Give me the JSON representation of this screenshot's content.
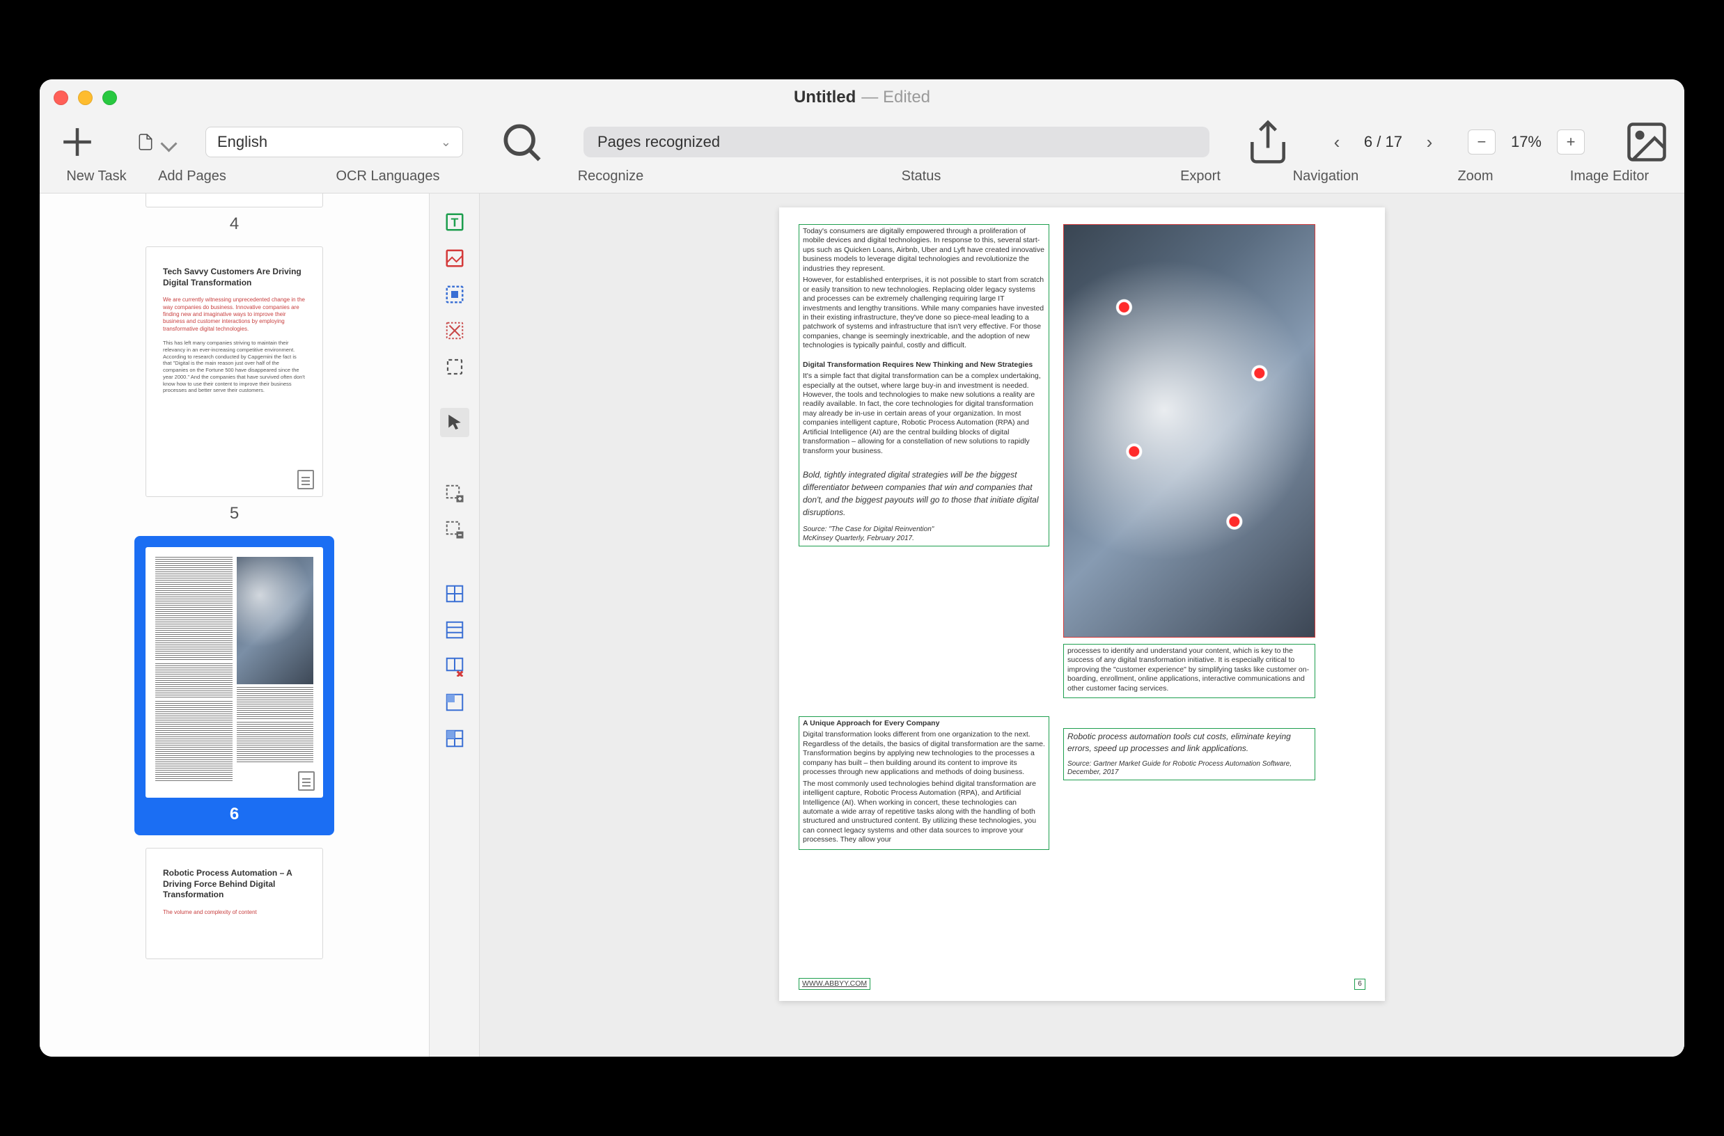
{
  "window": {
    "title": "Untitled",
    "edited": "— Edited"
  },
  "toolbar": {
    "newTask": "New Task",
    "addPages": "Add Pages",
    "language": "English",
    "ocrLanguages": "OCR Languages",
    "recognize": "Recognize",
    "status": "Status",
    "statusValue": "Pages recognized",
    "export": "Export",
    "navigation": "Navigation",
    "pageCounter": "6 / 17",
    "zoom": "Zoom",
    "zoomValue": "17%",
    "imageEditor": "Image Editor"
  },
  "thumbs": {
    "t4": {
      "label": "4"
    },
    "t5": {
      "label": "5",
      "head": "Tech Savvy Customers Are Driving Digital Transformation",
      "red": "We are currently witnessing unprecedented change in the way companies do business. Innovative companies are finding new and imaginative ways to improve their business and customer interactions by employing transformative digital technologies.",
      "body": "This has left many companies striving to maintain their relevancy in an ever-increasing competitive environment. According to research conducted by Capgemini the fact is that \"Digital is the main reason just over half of the companies on the Fortune 500 have disappeared since the year 2000.\" And the companies that have survived often don't know how to use their content to improve their business processes and better serve their customers."
    },
    "t6": {
      "label": "6"
    },
    "t7": {
      "head": "Robotic Process Automation – A Driving Force Behind Digital Transformation",
      "red": "The volume and complexity of content"
    }
  },
  "page": {
    "b1": {
      "p1": "Today's consumers are digitally empowered through a proliferation of mobile devices and digital technologies. In response to this, several start-ups such as Quicken Loans, Airbnb, Uber and Lyft have created innovative business models to leverage digital technologies and revolutionize the industries they represent.",
      "p2": "However, for established enterprises, it is not possible to start from scratch or easily transition to new technologies. Replacing older legacy systems and processes can be extremely challenging requiring large IT investments and lengthy transitions. While many companies have invested in their existing infrastructure, they've done so piece-meal leading to a patchwork of systems and infrastructure that isn't very effective. For those companies, change is seemingly inextricable, and the adoption of new technologies is typically painful, costly and difficult.",
      "head": "Digital Transformation Requires New Thinking and New Strategies",
      "p3": "It's a simple fact that digital transformation can be a complex undertaking, especially at the outset, where large buy-in and investment is needed. However, the tools and technologies to make new solutions a reality are readily available. In fact, the core technologies for digital transformation may already be in-use in certain areas of your organization. In most companies intelligent capture, Robotic Process Automation (RPA) and Artificial Intelligence (AI) are the central building blocks of digital transformation – allowing for a constellation of new solutions to rapidly transform your business.",
      "quote": "Bold, tightly integrated digital strategies will be the biggest differentiator between companies that win and companies that don't, and the biggest payouts will go to those that initiate digital disruptions.",
      "src1": "Source: \"The Case for Digital Reinvention\"",
      "src2": "McKinsey Quarterly, February 2017."
    },
    "b2": {
      "head": "A Unique Approach for Every Company",
      "p1": "Digital transformation looks different from one organization to the next. Regardless of the details, the basics of digital transformation are the same. Transformation begins by applying new technologies to the processes a company has built – then building around its content to improve its processes through new applications and methods of doing business.",
      "p2": "The most commonly used technologies behind digital transformation are intelligent capture, Robotic Process Automation (RPA), and Artificial Intelligence (AI). When working in concert, these technologies can automate a wide array of repetitive tasks along with the handling of both structured and unstructured content. By utilizing these technologies, you can connect legacy systems and other data sources to improve your processes. They allow your"
    },
    "b3": {
      "p1": "processes to identify and understand your content, which is key to the success of any digital transformation initiative. It is especially critical to improving the \"customer experience\" by simplifying tasks like customer on-boarding, enrollment, online applications, interactive communications and other customer facing services."
    },
    "b4": {
      "quote": "Robotic process automation tools cut costs, eliminate keying errors, speed up processes and link applications.",
      "src": "Source: Gartner Market Guide for Robotic Process Automation Software, December, 2017"
    },
    "footer": "WWW.ABBYY.COM",
    "pagenum": "6"
  }
}
